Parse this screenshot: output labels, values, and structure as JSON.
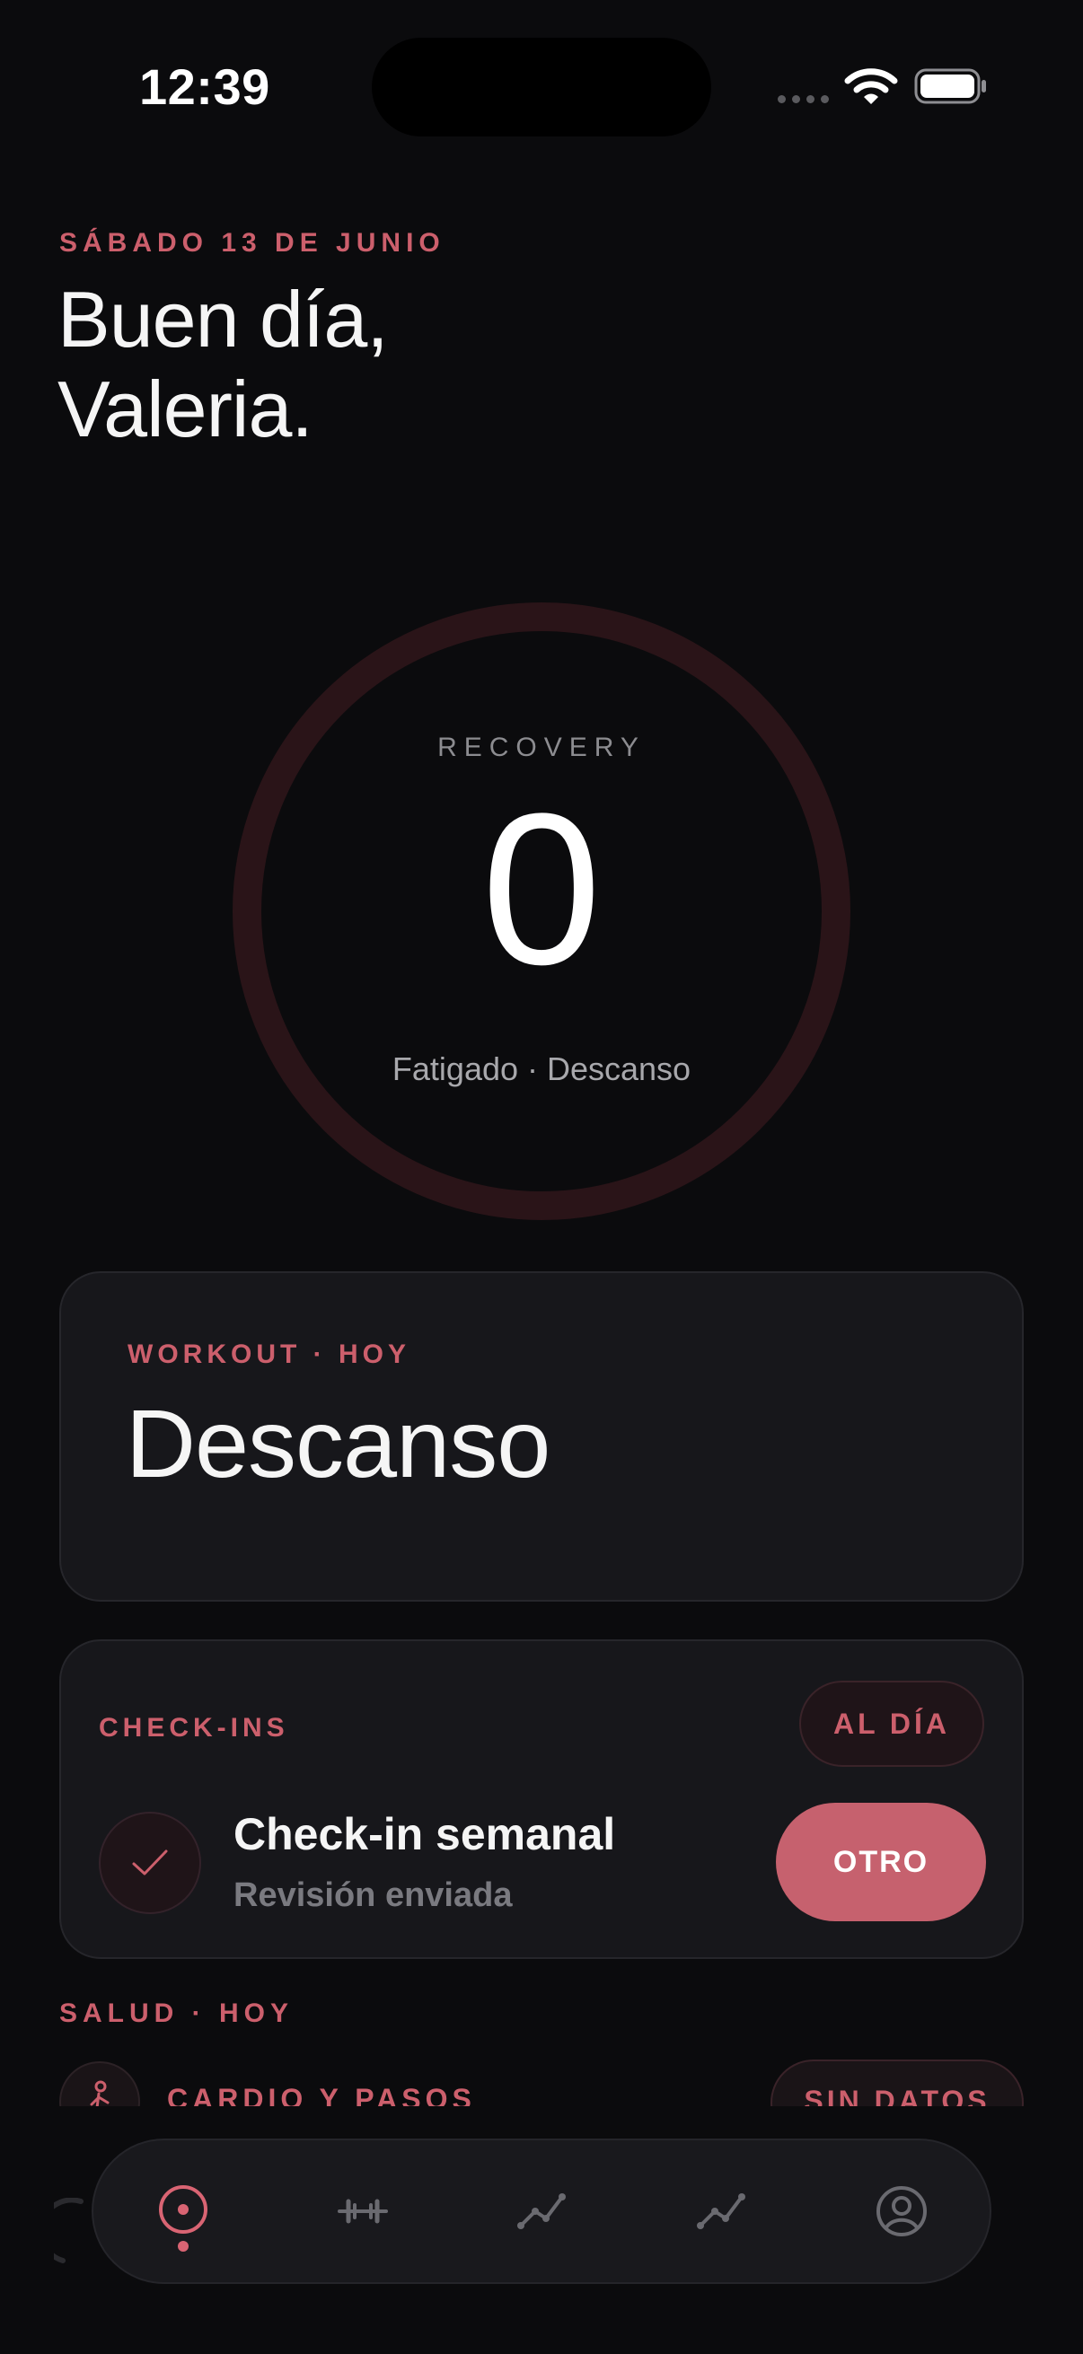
{
  "status_bar": {
    "time": "12:39",
    "icons": [
      "signal-dots-icon",
      "wifi-icon",
      "battery-icon"
    ]
  },
  "header": {
    "date": "SÁBADO 13 DE JUNIO",
    "greeting_line1": "Buen día,",
    "greeting_line2": "Valeria."
  },
  "recovery": {
    "label": "RECOVERY",
    "value": "0",
    "status": "Fatigado · Descanso",
    "ring_fill_fraction": 0
  },
  "workout": {
    "eyebrow": "WORKOUT · HOY",
    "title": "Descanso"
  },
  "checkins": {
    "eyebrow": "CHECK-INS",
    "status": "AL DÍA",
    "item_title": "Check-in semanal",
    "item_subtitle": "Revisión enviada",
    "other_button": "OTRO",
    "icon": "check-icon"
  },
  "health": {
    "label": "SALUD · HOY",
    "row_label": "CARDIO Y PASOS",
    "row_status": "SIN DATOS",
    "icon": "walking-person-icon"
  },
  "tab_bar": {
    "tabs": [
      {
        "icon": "home-target-icon",
        "active": true
      },
      {
        "icon": "dumbbell-icon",
        "active": false
      },
      {
        "icon": "trend-line-icon",
        "active": false
      },
      {
        "icon": "trend-line-icon",
        "active": false
      },
      {
        "icon": "profile-icon",
        "active": false
      }
    ]
  },
  "colors": {
    "background": "#0b0b0d",
    "accent": "#cc5f6c",
    "button": "#c6616e",
    "card": "#17171b",
    "ring_track": "#2a1418"
  }
}
